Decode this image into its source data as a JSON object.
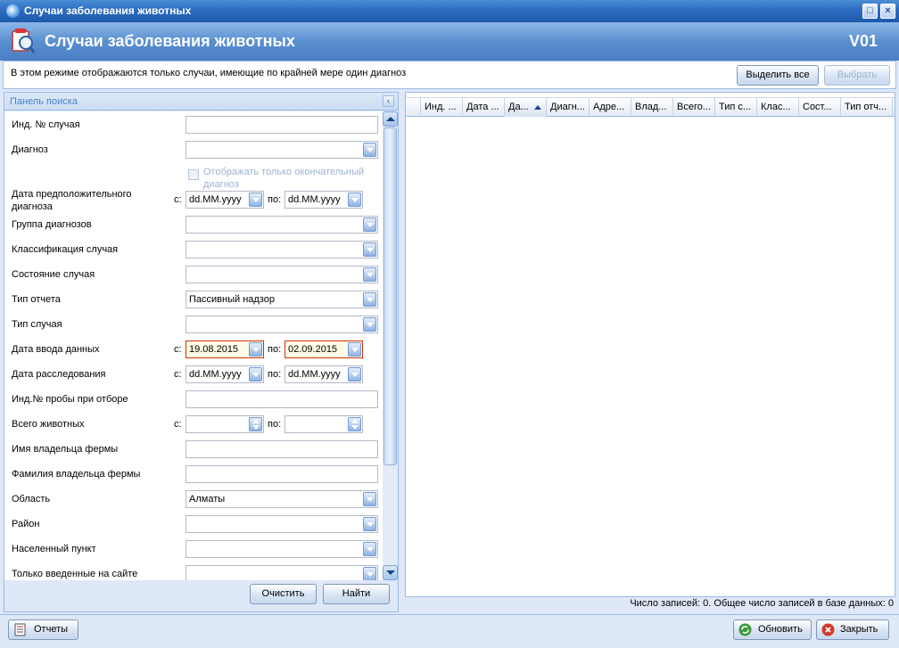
{
  "window": {
    "title": "Случаи заболевания животных"
  },
  "header": {
    "title": "Случаи заболевания животных",
    "code": "V01"
  },
  "info": {
    "text": "В этом режиме отображаются только случаи, имеющие по крайней мере один диагноз",
    "select_all_label": "Выделить все",
    "select_label": "Выбрать"
  },
  "search_panel": {
    "title": "Панель поиска",
    "fields": {
      "case_id": {
        "label": "Инд. № случая",
        "value": ""
      },
      "diagnosis": {
        "label": "Диагноз",
        "value": ""
      },
      "final_only": {
        "label": "Отображать только окончательный диагноз"
      },
      "tentative_date": {
        "label": "Дата предположительного диагноза",
        "from_label": "с:",
        "to_label": "по:",
        "from_value": "dd.MM.yyyy",
        "to_value": "dd.MM.yyyy"
      },
      "diagnosis_group": {
        "label": "Группа диагнозов",
        "value": ""
      },
      "case_classification": {
        "label": "Классификация случая",
        "value": ""
      },
      "case_status": {
        "label": "Состояние случая",
        "value": ""
      },
      "report_type": {
        "label": "Тип отчета",
        "value": "Пассивный надзор"
      },
      "case_type": {
        "label": "Тип случая",
        "value": ""
      },
      "entry_date": {
        "label": "Дата ввода данных",
        "from_label": "с:",
        "to_label": "по:",
        "from_value": "19.08.2015",
        "to_value": "02.09.2015"
      },
      "investigation_date": {
        "label": "Дата расследования",
        "from_label": "с:",
        "to_label": "по:",
        "from_value": "dd.MM.yyyy",
        "to_value": "dd.MM.yyyy"
      },
      "sample_id": {
        "label": "Инд.№ пробы при отборе",
        "value": ""
      },
      "total_animals": {
        "label": "Всего животных",
        "from_label": "с:",
        "to_label": "по:",
        "from_value": "",
        "to_value": ""
      },
      "owner_first_name": {
        "label": "Имя владельца фермы",
        "value": ""
      },
      "owner_last_name": {
        "label": "Фамилия владельца фермы",
        "value": ""
      },
      "region": {
        "label": "Область",
        "value": "Алматы"
      },
      "rayon": {
        "label": "Район",
        "value": ""
      },
      "settlement": {
        "label": "Населенный пункт",
        "value": ""
      },
      "site_only": {
        "label": "Только введенные на сайте",
        "value": ""
      }
    },
    "clear_label": "Очистить",
    "find_label": "Найти"
  },
  "grid": {
    "columns": [
      "Инд. ...",
      "Дата ...",
      "Да...",
      "Диагн...",
      "Адре...",
      "Влад...",
      "Всего...",
      "Тип с...",
      "Клас...",
      "Сост...",
      "Тип отч..."
    ],
    "sorted_column": 2,
    "status": "Число записей: 0. Общее число записей в базе данных: 0"
  },
  "footer": {
    "reports_label": "Отчеты",
    "refresh_label": "Обновить",
    "close_label": "Закрыть"
  },
  "colors": {
    "accent": "#15428b",
    "header": "#5a8fd0",
    "error_border": "#cc3300"
  }
}
